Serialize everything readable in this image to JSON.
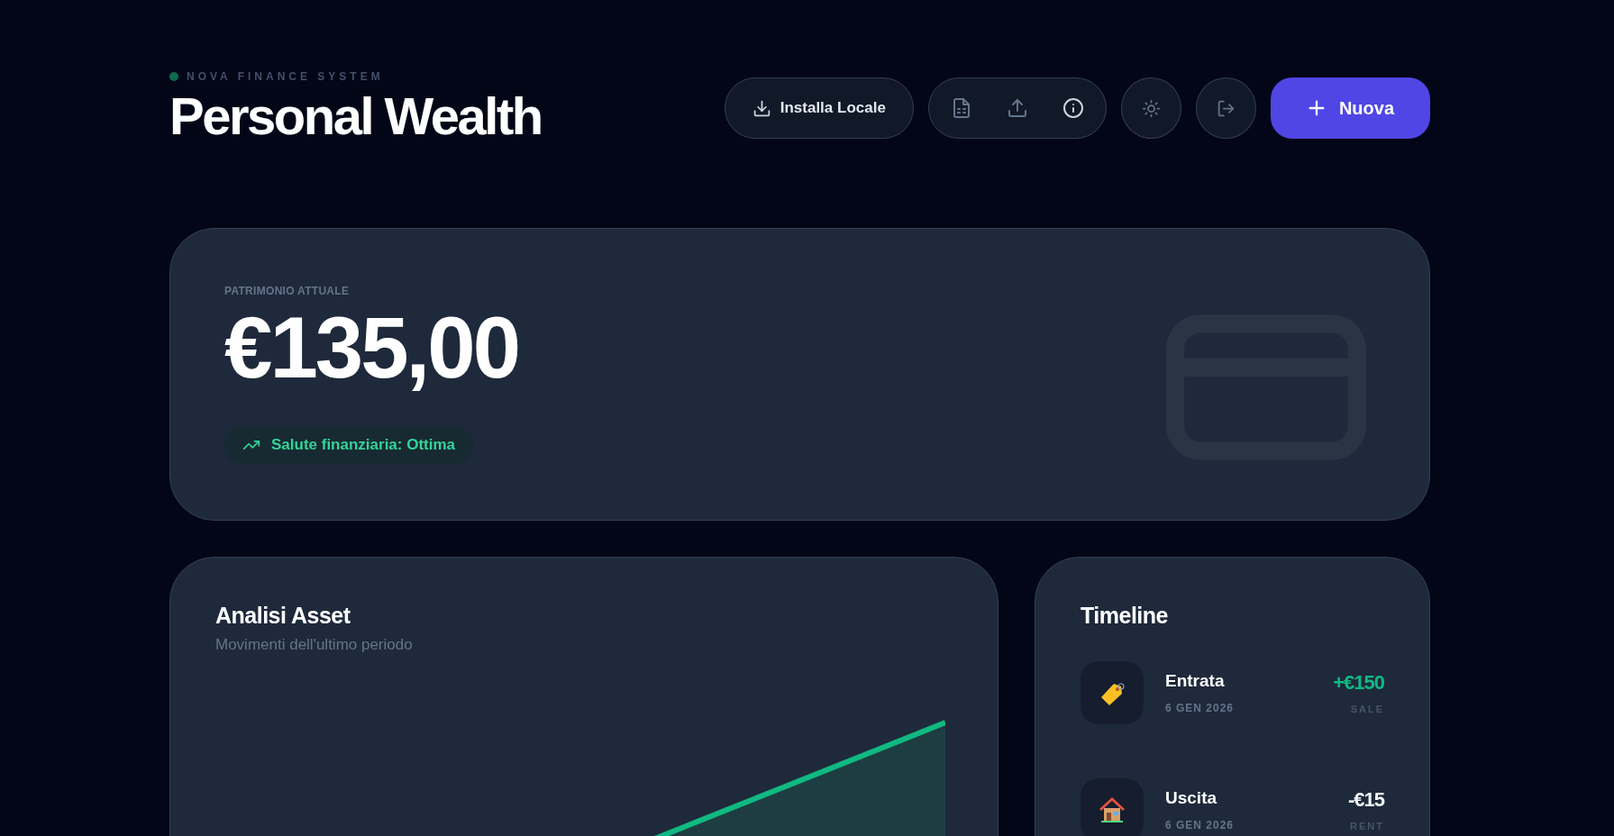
{
  "header": {
    "eyebrow": "NOVA FINANCE SYSTEM",
    "title": "Personal Wealth"
  },
  "toolbar": {
    "install_button": "Installa Locale",
    "new_button": "Nuova"
  },
  "balance": {
    "label": "PATRIMONIO ATTUALE",
    "amount": "€135,00",
    "health": "Salute finanziaria: Ottima"
  },
  "analysis": {
    "title": "Analisi Asset",
    "subtitle": "Movimenti dell'ultimo periodo"
  },
  "timeline": {
    "title": "Timeline",
    "items": [
      {
        "kind": "income",
        "title": "Entrata",
        "date": "6 GEN 2026",
        "amount": "+€150",
        "category": "SALE"
      },
      {
        "kind": "expense",
        "title": "Uscita",
        "date": "6 GEN 2026",
        "amount": "-€15",
        "category": "RENT"
      }
    ]
  }
}
